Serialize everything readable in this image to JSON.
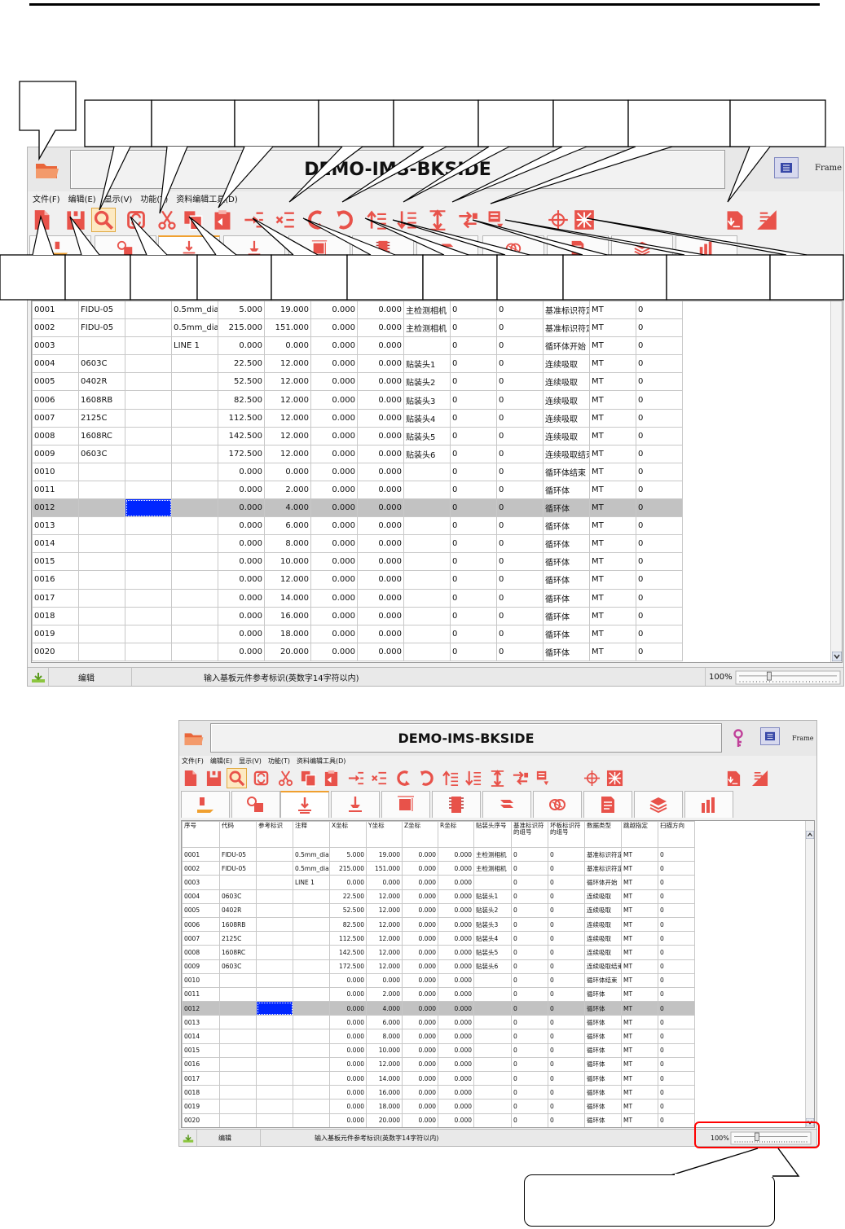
{
  "app": {
    "title": "DEMO-IMS-BKSIDE",
    "frame_label": "Frame",
    "menu": [
      "文件(F)",
      "编辑(E)",
      "显示(V)",
      "功能(T)",
      "资料编辑工具(D)"
    ]
  },
  "table": {
    "headers": [
      "序号",
      "代码",
      "参考标识",
      "注释",
      "X坐标",
      "Y坐标",
      "Z坐标",
      "R坐标",
      "贴装头序号",
      "基准标识符的组号",
      "坏板标识符的组号",
      "数据类型",
      "跳越指定",
      "扫描方向"
    ],
    "rows": [
      [
        "0001",
        "FIDU-05",
        "",
        "0.5mm_dia",
        "5.000",
        "19.000",
        "0.000",
        "0.000",
        "主检测相机",
        "0",
        "0",
        "基准标识符定位",
        "MT",
        "0"
      ],
      [
        "0002",
        "FIDU-05",
        "",
        "0.5mm_dia",
        "215.000",
        "151.000",
        "0.000",
        "0.000",
        "主检测相机",
        "0",
        "0",
        "基准标识符定位",
        "MT",
        "0"
      ],
      [
        "0003",
        "",
        "",
        "LINE 1",
        "0.000",
        "0.000",
        "0.000",
        "0.000",
        "",
        "0",
        "0",
        "循环体开始",
        "MT",
        "0"
      ],
      [
        "0004",
        "0603C",
        "",
        "",
        "22.500",
        "12.000",
        "0.000",
        "0.000",
        "贴装头1",
        "0",
        "0",
        "连续吸取",
        "MT",
        "0"
      ],
      [
        "0005",
        "0402R",
        "",
        "",
        "52.500",
        "12.000",
        "0.000",
        "0.000",
        "贴装头2",
        "0",
        "0",
        "连续吸取",
        "MT",
        "0"
      ],
      [
        "0006",
        "1608RB",
        "",
        "",
        "82.500",
        "12.000",
        "0.000",
        "0.000",
        "贴装头3",
        "0",
        "0",
        "连续吸取",
        "MT",
        "0"
      ],
      [
        "0007",
        "2125C",
        "",
        "",
        "112.500",
        "12.000",
        "0.000",
        "0.000",
        "贴装头4",
        "0",
        "0",
        "连续吸取",
        "MT",
        "0"
      ],
      [
        "0008",
        "1608RC",
        "",
        "",
        "142.500",
        "12.000",
        "0.000",
        "0.000",
        "贴装头5",
        "0",
        "0",
        "连续吸取",
        "MT",
        "0"
      ],
      [
        "0009",
        "0603C",
        "",
        "",
        "172.500",
        "12.000",
        "0.000",
        "0.000",
        "贴装头6",
        "0",
        "0",
        "连续吸取结束",
        "MT",
        "0"
      ],
      [
        "0010",
        "",
        "",
        "",
        "0.000",
        "0.000",
        "0.000",
        "0.000",
        "",
        "0",
        "0",
        "循环体结束",
        "MT",
        "0"
      ],
      [
        "0011",
        "",
        "",
        "",
        "0.000",
        "2.000",
        "0.000",
        "0.000",
        "",
        "0",
        "0",
        "循环体",
        "MT",
        "0"
      ],
      [
        "0012",
        "",
        "",
        "",
        "0.000",
        "4.000",
        "0.000",
        "0.000",
        "",
        "0",
        "0",
        "循环体",
        "MT",
        "0"
      ],
      [
        "0013",
        "",
        "",
        "",
        "0.000",
        "6.000",
        "0.000",
        "0.000",
        "",
        "0",
        "0",
        "循环体",
        "MT",
        "0"
      ],
      [
        "0014",
        "",
        "",
        "",
        "0.000",
        "8.000",
        "0.000",
        "0.000",
        "",
        "0",
        "0",
        "循环体",
        "MT",
        "0"
      ],
      [
        "0015",
        "",
        "",
        "",
        "0.000",
        "10.000",
        "0.000",
        "0.000",
        "",
        "0",
        "0",
        "循环体",
        "MT",
        "0"
      ],
      [
        "0016",
        "",
        "",
        "",
        "0.000",
        "12.000",
        "0.000",
        "0.000",
        "",
        "0",
        "0",
        "循环体",
        "MT",
        "0"
      ],
      [
        "0017",
        "",
        "",
        "",
        "0.000",
        "14.000",
        "0.000",
        "0.000",
        "",
        "0",
        "0",
        "循环体",
        "MT",
        "0"
      ],
      [
        "0018",
        "",
        "",
        "",
        "0.000",
        "16.000",
        "0.000",
        "0.000",
        "",
        "0",
        "0",
        "循环体",
        "MT",
        "0"
      ],
      [
        "0019",
        "",
        "",
        "",
        "0.000",
        "18.000",
        "0.000",
        "0.000",
        "",
        "0",
        "0",
        "循环体",
        "MT",
        "0"
      ],
      [
        "0020",
        "",
        "",
        "",
        "0.000",
        "20.000",
        "0.000",
        "0.000",
        "",
        "0",
        "0",
        "循环体",
        "MT",
        "0"
      ]
    ],
    "selected_row": "0012"
  },
  "status": {
    "mode": "编辑",
    "message": "输入基板元件参考标识(英数字14字符以内)",
    "zoom": "100%",
    "zoom_value": 0.3
  },
  "colors": {
    "icon_red": "#e8524a",
    "selection_blue": "#0026ff",
    "highlight_red": "#ff0000",
    "folder_orange": "#e9663a"
  },
  "icons": {
    "toolbar": [
      "new-file-icon",
      "save-icon",
      "search-icon",
      "find-replace-icon",
      "cut-icon",
      "copy-icon",
      "paste-icon",
      "insert-row-icon",
      "delete-row-icon",
      "undo-icon",
      "redo-icon",
      "sort-ascending-icon",
      "sort-descending-icon",
      "swap-rows-icon",
      "move-data-icon",
      "mark-list-icon",
      "crosshair-icon",
      "optimize-icon",
      "export-file-icon",
      "ratio-icon"
    ],
    "tabs": [
      "placement-tab-icon",
      "component-tab-icon",
      "head-tab-icon",
      "nozzle-tab-icon",
      "board-tab-icon",
      "feeder-tab-icon",
      "tape-tab-icon",
      "parts-tab-icon",
      "document-tab-icon",
      "layer-tab-icon",
      "chart-tab-icon"
    ]
  }
}
